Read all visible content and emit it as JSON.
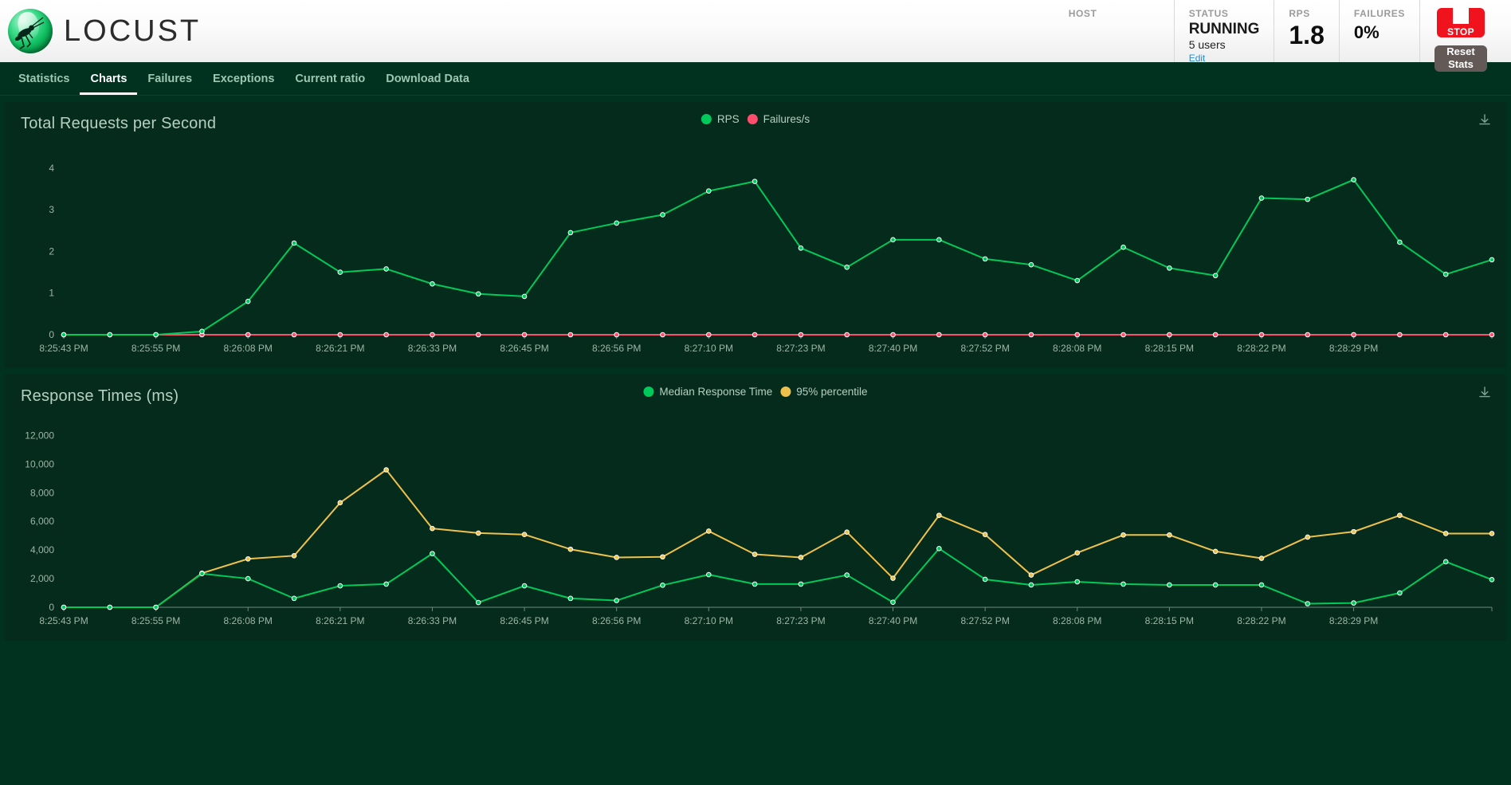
{
  "header": {
    "logo_text": "LOCUST",
    "stats": [
      {
        "label": "HOST",
        "value": ""
      },
      {
        "label": "STATUS",
        "value": "RUNNING",
        "sub": "5 users",
        "edit": "Edit"
      },
      {
        "label": "RPS",
        "value": "1.8"
      },
      {
        "label": "FAILURES",
        "value": "0%"
      }
    ],
    "stop_button": "STOP",
    "reset_button_line1": "Reset",
    "reset_button_line2": "Stats"
  },
  "nav": {
    "items": [
      {
        "label": "Statistics",
        "active": false
      },
      {
        "label": "Charts",
        "active": true
      },
      {
        "label": "Failures",
        "active": false
      },
      {
        "label": "Exceptions",
        "active": false
      },
      {
        "label": "Current ratio",
        "active": false
      },
      {
        "label": "Download Data",
        "active": false
      }
    ]
  },
  "colors": {
    "rps_green": "#00ca5a",
    "failures_pink": "#ff4d6e",
    "median_green": "#00ca5a",
    "percentile_yellow": "#eec14c",
    "panel_bg": "#052b1c",
    "page_bg": "#00321f",
    "axis_text": "#9db5a8",
    "title_text": "#b7cfc2",
    "nav_active": "#ffffff",
    "nav_inactive": "#9ec7b3",
    "stop_red": "#f0131e",
    "reset_brown": "#635a58",
    "edit_link": "#1f8ed6"
  },
  "chart_data": [
    {
      "type": "line",
      "title": "Total Requests per Second",
      "xlabel": "",
      "ylabel": "",
      "ylim": [
        0,
        4.4
      ],
      "yticks": [
        0,
        1,
        2,
        3,
        4
      ],
      "ytick_labels": [
        "0",
        "1",
        "2",
        "3",
        "4"
      ],
      "grid": false,
      "legend_position": "top-center",
      "x_tick_labels": [
        "8:25:43 PM",
        "8:25:55 PM",
        "8:26:08 PM",
        "8:26:21 PM",
        "8:26:33 PM",
        "8:26:45 PM",
        "8:26:56 PM",
        "8:27:10 PM",
        "8:27:23 PM",
        "8:27:40 PM",
        "8:27:52 PM",
        "8:28:08 PM",
        "8:28:15 PM",
        "8:28:22 PM",
        "8:28:29 PM"
      ],
      "x_tick_indices": [
        0,
        2,
        4,
        6,
        8,
        10,
        12,
        14,
        16,
        18,
        20,
        22,
        24,
        26,
        28
      ],
      "series": [
        {
          "name": "RPS",
          "color": "#00ca5a",
          "values": [
            0,
            0,
            0,
            0.08,
            0.8,
            2.2,
            1.5,
            1.58,
            1.22,
            0.98,
            0.92,
            2.45,
            2.68,
            2.88,
            3.45,
            3.68,
            2.08,
            1.62,
            2.28,
            2.28,
            1.82,
            1.68,
            1.3,
            2.1,
            1.6,
            1.42,
            3.28,
            3.25,
            3.72,
            2.22,
            1.45,
            1.8
          ]
        },
        {
          "name": "Failures/s",
          "color": "#ff4d6e",
          "values": [
            0,
            0,
            0,
            0,
            0,
            0,
            0,
            0,
            0,
            0,
            0,
            0,
            0,
            0,
            0,
            0,
            0,
            0,
            0,
            0,
            0,
            0,
            0,
            0,
            0,
            0,
            0,
            0,
            0,
            0,
            0,
            0
          ]
        }
      ]
    },
    {
      "type": "line",
      "title": "Response Times (ms)",
      "xlabel": "",
      "ylabel": "",
      "ylim": [
        0,
        12800
      ],
      "yticks": [
        0,
        2000,
        4000,
        6000,
        8000,
        10000,
        12000
      ],
      "ytick_labels": [
        "0",
        "2,000",
        "4,000",
        "6,000",
        "8,000",
        "10,000",
        "12,000"
      ],
      "grid": false,
      "legend_position": "top-center",
      "x_tick_labels": [
        "8:25:43 PM",
        "8:25:55 PM",
        "8:26:08 PM",
        "8:26:21 PM",
        "8:26:33 PM",
        "8:26:45 PM",
        "8:26:56 PM",
        "8:27:10 PM",
        "8:27:23 PM",
        "8:27:40 PM",
        "8:27:52 PM",
        "8:28:08 PM",
        "8:28:15 PM",
        "8:28:22 PM",
        "8:28:29 PM"
      ],
      "x_tick_indices": [
        0,
        2,
        4,
        6,
        8,
        10,
        12,
        14,
        16,
        18,
        20,
        22,
        24,
        26,
        28
      ],
      "series": [
        {
          "name": "Median Response Time",
          "color": "#00ca5a",
          "values": [
            0,
            0,
            0,
            2350,
            2000,
            620,
            1500,
            1620,
            3750,
            330,
            1500,
            620,
            470,
            1540,
            2280,
            1620,
            1620,
            2250,
            350,
            4100,
            1950,
            1560,
            1780,
            1620,
            1560,
            1560,
            1560,
            250,
            300,
            1000,
            3180,
            1930
          ]
        },
        {
          "name": "95% percentile",
          "color": "#eec14c",
          "values": [
            0,
            0,
            0,
            2380,
            3380,
            3600,
            7300,
            9600,
            5500,
            5180,
            5080,
            4050,
            3480,
            3520,
            5320,
            3700,
            3480,
            5250,
            2030,
            6420,
            5080,
            2250,
            3800,
            5050,
            5050,
            3900,
            3420,
            4900,
            5280,
            6420,
            5150,
            5150
          ]
        }
      ]
    }
  ]
}
